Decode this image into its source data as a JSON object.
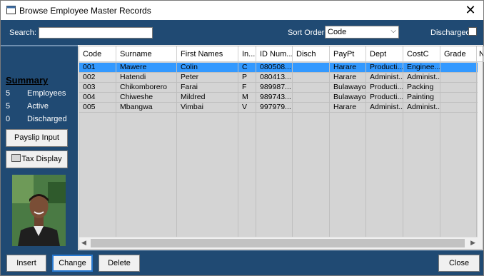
{
  "window": {
    "title": "Browse Employee Master Records",
    "close_glyph": "✕"
  },
  "toolbar": {
    "search_label": "Search:",
    "search_value": "",
    "sort_label": "Sort Order",
    "sort_value": "Code",
    "discharged_label": "Discharged",
    "discharged_checked": false
  },
  "summary": {
    "title": "Summary",
    "rows": [
      {
        "count": "5",
        "label": "Employees"
      },
      {
        "count": "5",
        "label": "Active"
      },
      {
        "count": "0",
        "label": "Discharged"
      }
    ],
    "payslip_button": "Payslip Input",
    "tax_button": "Tax Display"
  },
  "grid": {
    "columns": [
      "Code",
      "Surname",
      "First Names",
      "In...",
      "ID Num...",
      "Disch",
      "PayPt",
      "Dept",
      "CostC",
      "Grade",
      "N"
    ],
    "rows": [
      [
        "001",
        "Mawere",
        "Colin",
        "C",
        "080508...",
        "",
        "Harare",
        "Producti...",
        "Enginee...",
        "",
        ""
      ],
      [
        "002",
        "Hatendi",
        "Peter",
        "P",
        "080413...",
        "",
        "Harare",
        "Administ...",
        "Administ...",
        "",
        ""
      ],
      [
        "003",
        "Chikomborero",
        "Farai",
        "F",
        "989987...",
        "",
        "Bulawayo",
        "Producti...",
        "Packing",
        "",
        ""
      ],
      [
        "004",
        "Chiweshe",
        "Mildred",
        "M",
        "989743...",
        "",
        "Bulawayo",
        "Producti...",
        "Painting",
        "",
        ""
      ],
      [
        "005",
        "Mbangwa",
        "Vimbai",
        "V",
        "997979...",
        "",
        "Harare",
        "Administ...",
        "Administ...",
        "",
        ""
      ]
    ],
    "selected_row": 0
  },
  "buttons": {
    "insert": "Insert",
    "change": "Change",
    "delete": "Delete",
    "close": "Close"
  },
  "colors": {
    "panel": "#204a73",
    "selection": "#3399ff",
    "grid_body": "#d4d4d4"
  }
}
